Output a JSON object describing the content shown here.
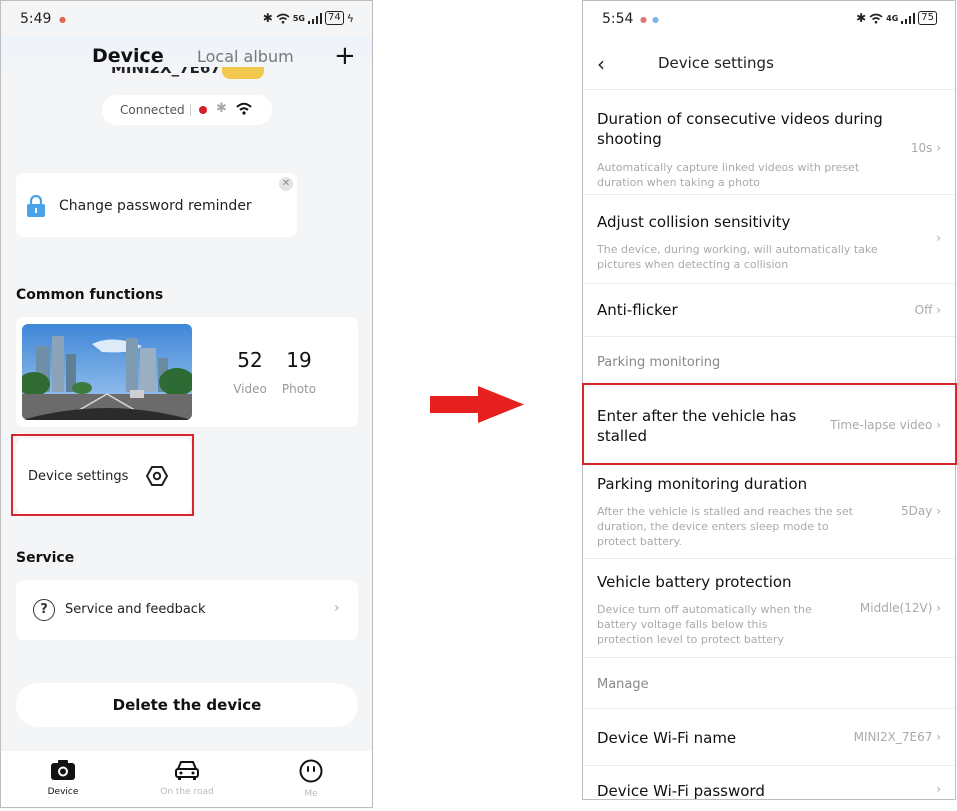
{
  "left": {
    "status_time": "5:49",
    "status_network": "5G",
    "battery": "74",
    "tab_device": "Device",
    "tab_local_album": "Local album",
    "device_name_partial": "MINI2X_7E67",
    "connection_status": "Connected",
    "reminder_text": "Change password reminder",
    "common_functions_title": "Common functions",
    "video_count": "52",
    "video_label": "Video",
    "photo_count": "19",
    "photo_label": "Photo",
    "device_settings_label": "Device settings",
    "service_title": "Service",
    "service_feedback_label": "Service and feedback",
    "delete_button_label": "Delete the device",
    "nav": {
      "device": "Device",
      "on_the_road": "On the road",
      "me": "Me"
    }
  },
  "right": {
    "status_time": "5:54",
    "status_network": "4G",
    "battery": "75",
    "title": "Device settings",
    "rows": [
      {
        "title": "Duration of consecutive videos during shooting",
        "desc": "Automatically capture linked videos with preset duration when taking a photo",
        "value": "10s"
      },
      {
        "title": "Adjust collision sensitivity",
        "desc": "The device, during working, will automatically take pictures when detecting a collision",
        "value": ""
      },
      {
        "title": "Anti-flicker",
        "desc": "",
        "value": "Off"
      }
    ],
    "group_parking": "Parking monitoring",
    "parking_rows": [
      {
        "title": "Enter after the vehicle has stalled",
        "desc": "",
        "value": "Time-lapse video"
      },
      {
        "title": "Parking monitoring duration",
        "desc": "After the vehicle is stalled and reaches the set duration, the device enters sleep mode to protect battery.",
        "value": "5Day"
      },
      {
        "title": "Vehicle battery protection",
        "desc": "Device turn off automatically when the battery voltage falls below this protection level to protect battery",
        "value": "Middle(12V)"
      }
    ],
    "group_manage": "Manage",
    "manage_rows": [
      {
        "title": "Device Wi-Fi name",
        "value": "MINI2X_7E67"
      },
      {
        "title": "Device Wi-Fi password",
        "value": ""
      }
    ]
  },
  "colors": {
    "highlight_red": "#d8262c",
    "arrow_red": "#e5201f",
    "lock_blue": "#4aa3e8",
    "connected_dot": "#d61f26"
  }
}
